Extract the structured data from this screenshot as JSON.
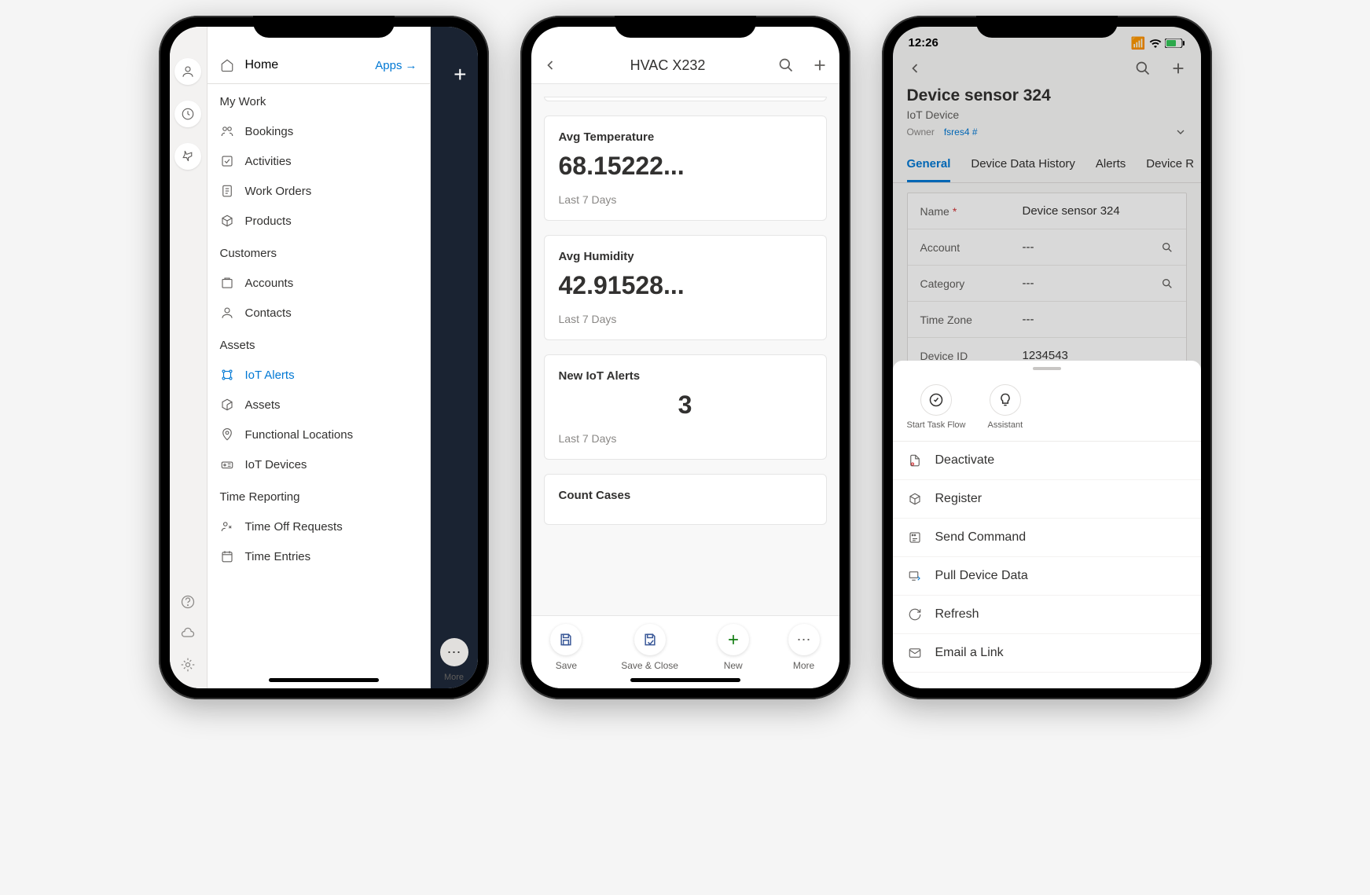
{
  "phone1": {
    "home_label": "Home",
    "apps_link": "Apps",
    "sections": {
      "my_work": {
        "header": "My Work",
        "items": [
          "Bookings",
          "Activities",
          "Work Orders",
          "Products"
        ]
      },
      "customers": {
        "header": "Customers",
        "items": [
          "Accounts",
          "Contacts"
        ]
      },
      "assets": {
        "header": "Assets",
        "items": [
          "IoT Alerts",
          "Assets",
          "Functional Locations",
          "IoT Devices"
        ],
        "active_index": 0
      },
      "time": {
        "header": "Time Reporting",
        "items": [
          "Time Off Requests",
          "Time Entries"
        ]
      }
    },
    "more_label": "More"
  },
  "phone2": {
    "title": "HVAC X232",
    "cards": [
      {
        "label": "Avg Temperature",
        "value": "68.15222...",
        "period": "Last 7 Days"
      },
      {
        "label": "Avg Humidity",
        "value": "42.91528...",
        "period": "Last 7 Days"
      },
      {
        "label": "New IoT Alerts",
        "value": "3",
        "period": "Last 7 Days",
        "center": true
      },
      {
        "label": "Count Cases",
        "value": "",
        "period": ""
      }
    ],
    "footer": [
      "Save",
      "Save & Close",
      "New",
      "More"
    ]
  },
  "phone3": {
    "status_time": "12:26",
    "title": "Device sensor 324",
    "subtitle": "IoT Device",
    "owner_label": "Owner",
    "owner_value": "fsres4 #",
    "tabs": [
      "General",
      "Device Data History",
      "Alerts",
      "Device R"
    ],
    "active_tab": 0,
    "fields": [
      {
        "label": "Name",
        "value": "Device sensor 324",
        "required": true
      },
      {
        "label": "Account",
        "value": "---",
        "search": true
      },
      {
        "label": "Category",
        "value": "---",
        "search": true
      },
      {
        "label": "Time Zone",
        "value": "---"
      },
      {
        "label": "Device ID",
        "value": "1234543"
      }
    ],
    "sheet_top": [
      "Start Task Flow",
      "Assistant"
    ],
    "sheet_items": [
      "Deactivate",
      "Register",
      "Send Command",
      "Pull Device Data",
      "Refresh",
      "Email a Link"
    ]
  }
}
